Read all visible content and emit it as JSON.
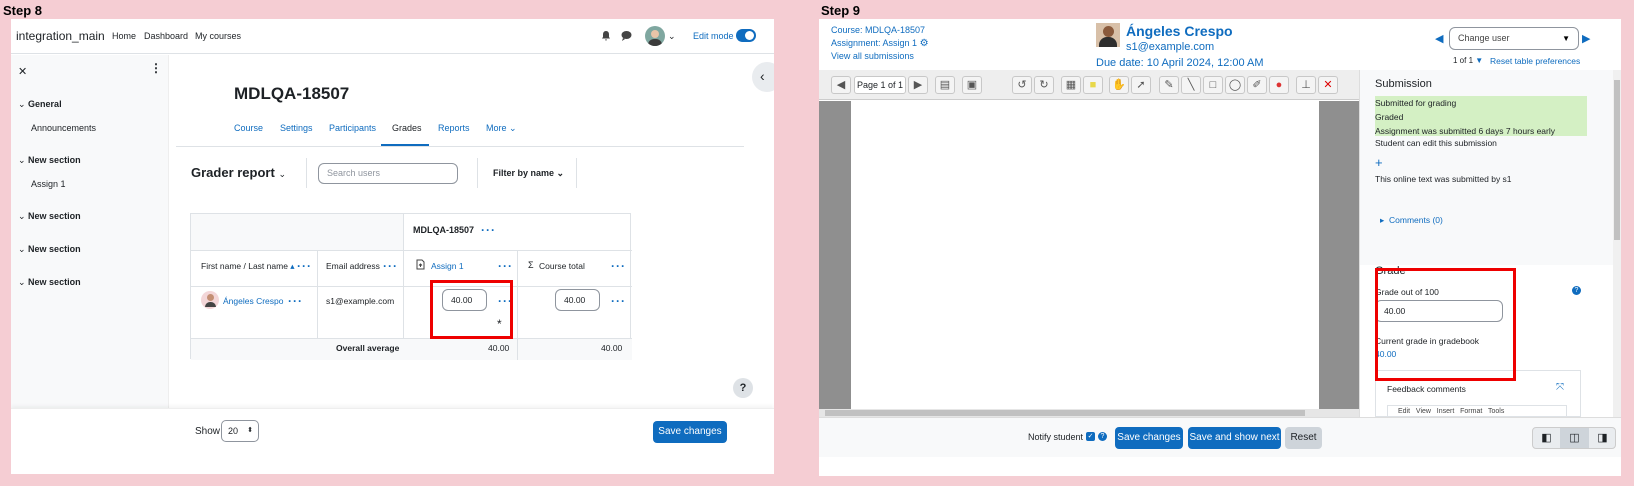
{
  "step8": {
    "label": "Step 8",
    "navbar": {
      "site": "integration_main",
      "links": [
        "Home",
        "Dashboard",
        "My courses"
      ],
      "edit_mode": "Edit mode"
    },
    "drawer": {
      "close": "✕",
      "sections": [
        {
          "title": "General",
          "items": [
            "Announcements"
          ]
        },
        {
          "title": "New section",
          "items": [
            "Assign 1"
          ]
        },
        {
          "title": "New section",
          "items": []
        },
        {
          "title": "New section",
          "items": []
        },
        {
          "title": "New section",
          "items": []
        }
      ]
    },
    "course_title": "MDLQA-18507",
    "tabs": [
      "Course",
      "Settings",
      "Participants",
      "Grades",
      "Reports",
      "More"
    ],
    "active_tab": "Grades",
    "report": {
      "title": "Grader report",
      "search_placeholder": "Search users",
      "filter": "Filter by name"
    },
    "table": {
      "group_header": "MDLQA-18507",
      "col_name": "First name / Last name",
      "col_email": "Email address",
      "col_assign": "Assign 1",
      "col_total": "Course total",
      "row": {
        "name": "Ángeles Crespo",
        "email": "s1@example.com",
        "grade": "40.00",
        "total": "40.00",
        "flag": "*"
      },
      "footer": {
        "label": "Overall average",
        "assign": "40.00",
        "total": "40.00"
      }
    },
    "help": "?",
    "footer": {
      "show_label": "Show",
      "show_value": "20",
      "save": "Save changes"
    }
  },
  "step9": {
    "label": "Step 9",
    "header": {
      "course": "Course: MDLQA-18507",
      "assignment": "Assignment: Assign 1",
      "view_all": "View all submissions",
      "student": "Ángeles Crespo",
      "email": "s1@example.com",
      "due": "Due date: 10 April 2024, 12:00 AM",
      "change_user": "Change user",
      "count": "1 of 1",
      "reset": "Reset table preferences"
    },
    "toolbar": {
      "page": "Page 1 of 1"
    },
    "submission": {
      "title": "Submission",
      "status": [
        "Submitted for grading",
        "Graded",
        "Assignment was submitted 6 days 7 hours early"
      ],
      "edit": "Student can edit this submission",
      "plus": "+",
      "online_text": "This online text was submitted by s1",
      "comments": "Comments (0)"
    },
    "grade": {
      "title": "Grade",
      "out_of": "Grade out of 100",
      "value": "40.00",
      "current_label": "Current grade in gradebook",
      "current_value": "40.00"
    },
    "feedback": {
      "title": "Feedback comments",
      "menu": "Edit   View   Insert   Format   Tools"
    },
    "footer": {
      "notify": "Notify student",
      "save": "Save changes",
      "save_next": "Save and show next",
      "reset": "Reset"
    },
    "colors": {
      "accent": "#0f6cbf",
      "graded_bg": "#d4f0c4",
      "highlight": "#e00000"
    }
  }
}
